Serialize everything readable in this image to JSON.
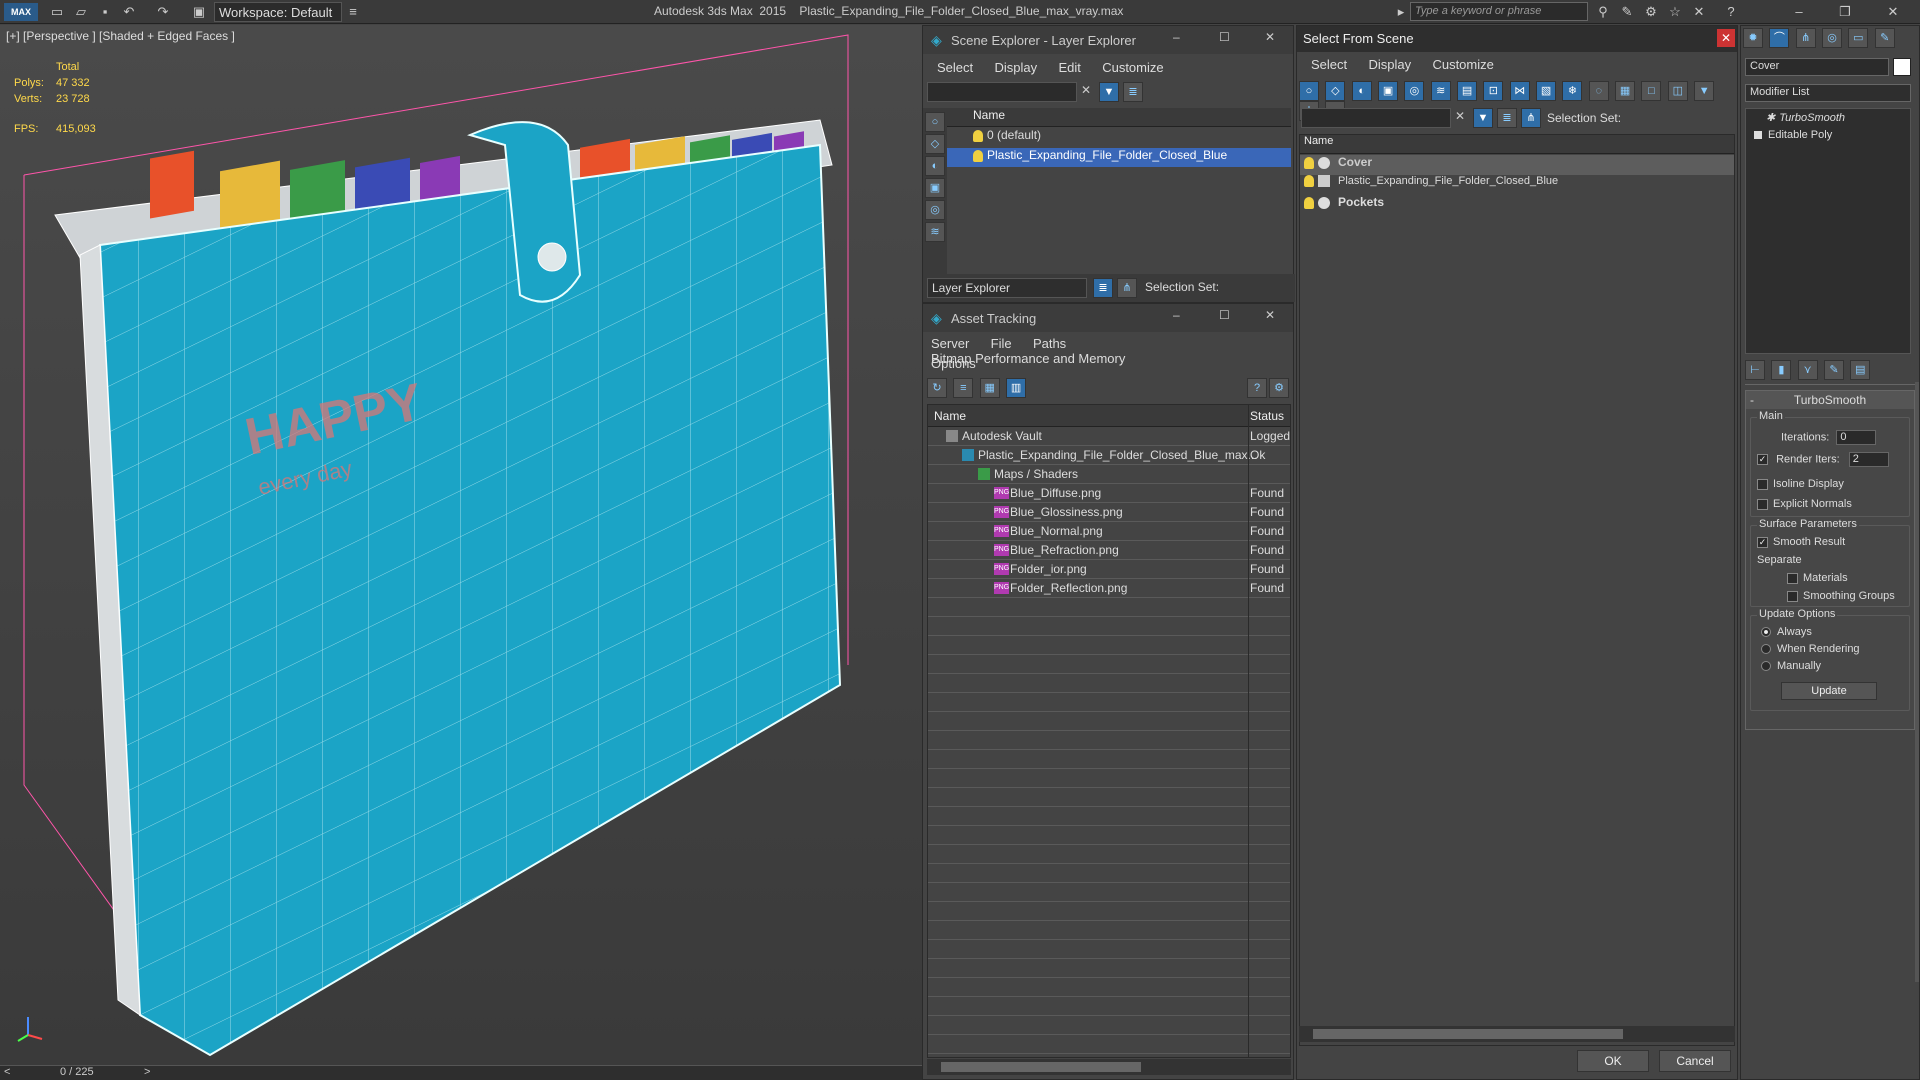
{
  "app": {
    "title": "Autodesk 3ds Max  2015    Plastic_Expanding_File_Folder_Closed_Blue_max_vray.max",
    "workspace": "Workspace: Default",
    "search_placeholder": "Type a keyword or phrase",
    "logo": "MAX"
  },
  "viewport": {
    "label": "[+] [Perspective ] [Shaded + Edged Faces ]",
    "total_label": "Total",
    "polys_label": "Polys:",
    "polys": "47 332",
    "verts_label": "Verts:",
    "verts": "23 728",
    "fps_label": "FPS:",
    "fps": "415,093",
    "folder_text_big": "HAPPY",
    "folder_text_small": "every day",
    "timeline": "0 / 225",
    "nav_prev": "<",
    "nav_next": ">"
  },
  "scene_explorer": {
    "title": "Scene Explorer - Layer Explorer",
    "menu": [
      "Select",
      "Display",
      "Edit",
      "Customize"
    ],
    "col_name": "Name",
    "rows": [
      "0 (default)",
      "Plastic_Expanding_File_Folder_Closed_Blue"
    ],
    "footer_dropdown": "Layer Explorer",
    "selection_set": "Selection Set:"
  },
  "asset_tracking": {
    "title": "Asset Tracking",
    "menu": [
      "Server",
      "File",
      "Paths",
      "Bitmap Performance and Memory"
    ],
    "menu2": "Options",
    "col_name": "Name",
    "col_status": "Status",
    "rows": [
      {
        "name": "Autodesk Vault",
        "status": "Logged"
      },
      {
        "name": "Plastic_Expanding_File_Folder_Closed_Blue_max...",
        "status": "Ok"
      },
      {
        "name": "Maps / Shaders",
        "status": ""
      },
      {
        "name": "Blue_Diffuse.png",
        "status": "Found"
      },
      {
        "name": "Blue_Glossiness.png",
        "status": "Found"
      },
      {
        "name": "Blue_Normal.png",
        "status": "Found"
      },
      {
        "name": "Blue_Refraction.png",
        "status": "Found"
      },
      {
        "name": "Folder_ior.png",
        "status": "Found"
      },
      {
        "name": "Folder_Reflection.png",
        "status": "Found"
      }
    ],
    "png_badge": "PNG"
  },
  "select_from_scene": {
    "title": "Select From Scene",
    "menu": [
      "Select",
      "Display",
      "Customize"
    ],
    "selection_set": "Selection Set:",
    "col_name": "Name",
    "rows": [
      "Cover",
      "Plastic_Expanding_File_Folder_Closed_Blue",
      "Pockets"
    ],
    "ok": "OK",
    "cancel": "Cancel"
  },
  "modifier_panel": {
    "object_name": "Cover",
    "modifier_list": "Modifier List",
    "stack": [
      "TurboSmooth",
      "Editable Poly"
    ],
    "rollout_title": "TurboSmooth",
    "main": "Main",
    "iterations_label": "Iterations:",
    "iterations": "0",
    "render_iters_label": "Render Iters:",
    "render_iters": "2",
    "isoline": "Isoline Display",
    "explicit": "Explicit Normals",
    "surface_params": "Surface Parameters",
    "smooth_result": "Smooth Result",
    "separate": "Separate",
    "materials": "Materials",
    "smoothing_groups": "Smoothing Groups",
    "update_options": "Update Options",
    "always": "Always",
    "when_rendering": "When Rendering",
    "manually": "Manually",
    "update": "Update"
  }
}
